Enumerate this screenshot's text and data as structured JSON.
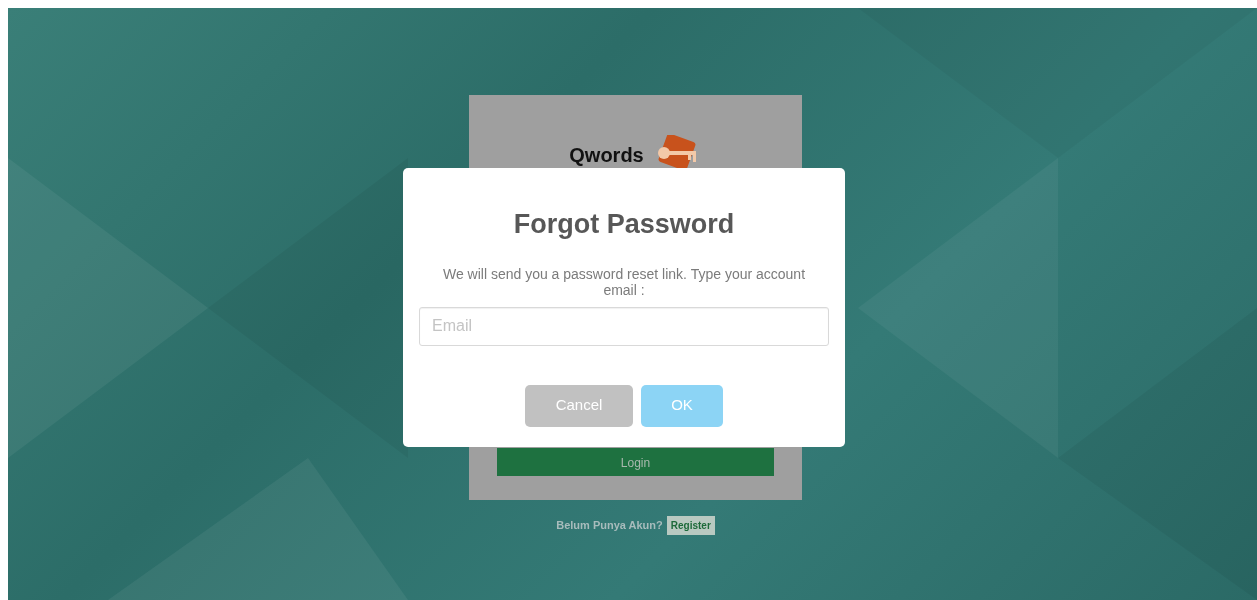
{
  "login_card": {
    "logo_text": "Qwords",
    "login_button": "Login"
  },
  "register_prompt": {
    "text": "Belum Punya Akun?",
    "button": "Register"
  },
  "dialog": {
    "title": "Forgot Password",
    "message": "We will send you a password reset link. Type your account email :",
    "email_field": {
      "placeholder": "Email"
    },
    "buttons": [
      {
        "label": "Cancel",
        "kind": "cancel"
      },
      {
        "label": "OK",
        "kind": "confirm"
      }
    ]
  }
}
